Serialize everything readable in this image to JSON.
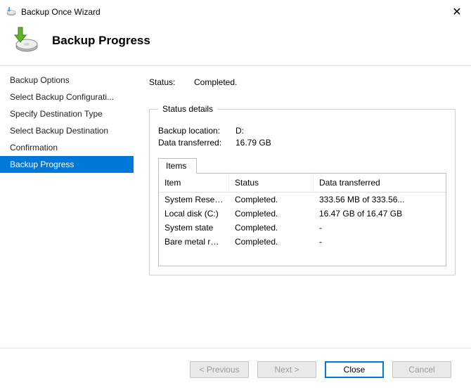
{
  "window": {
    "title": "Backup Once Wizard"
  },
  "header": {
    "title": "Backup Progress"
  },
  "sidebar": {
    "items": [
      {
        "label": "Backup Options"
      },
      {
        "label": "Select Backup Configurati..."
      },
      {
        "label": "Specify Destination Type"
      },
      {
        "label": "Select Backup Destination"
      },
      {
        "label": "Confirmation"
      },
      {
        "label": "Backup Progress"
      }
    ],
    "selected_index": 5
  },
  "status": {
    "label": "Status:",
    "value": "Completed."
  },
  "details": {
    "legend": "Status details",
    "backup_location": {
      "label": "Backup location:",
      "value": "D:"
    },
    "data_transferred": {
      "label": "Data transferred:",
      "value": "16.79 GB"
    },
    "tab_label": "Items",
    "columns": {
      "item": "Item",
      "status": "Status",
      "data_transferred": "Data transferred"
    },
    "rows": [
      {
        "item": "System Reserv...",
        "status": "Completed.",
        "dt": "333.56 MB of 333.56..."
      },
      {
        "item": "Local disk (C:)",
        "status": "Completed.",
        "dt": "16.47 GB of 16.47 GB"
      },
      {
        "item": "System state",
        "status": "Completed.",
        "dt": "-"
      },
      {
        "item": "Bare metal rec...",
        "status": "Completed.",
        "dt": "-"
      }
    ]
  },
  "buttons": {
    "previous": "< Previous",
    "next": "Next >",
    "close": "Close",
    "cancel": "Cancel"
  }
}
